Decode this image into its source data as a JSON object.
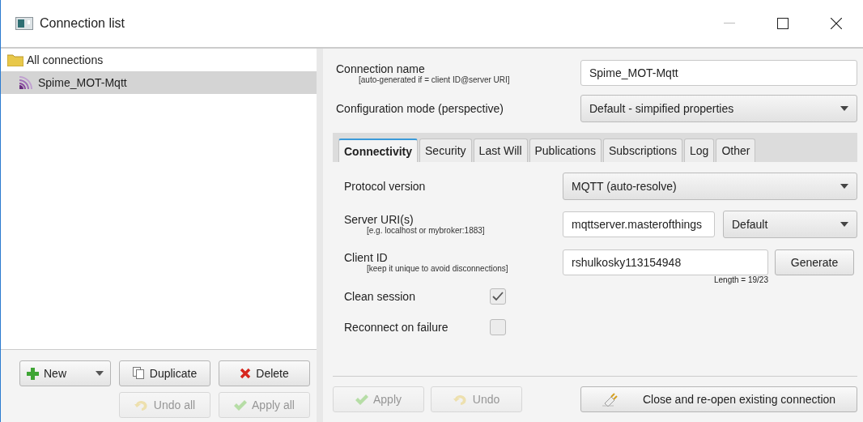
{
  "window": {
    "title": "Connection list"
  },
  "tree": [
    {
      "label": "All connections",
      "kind": "folder",
      "selected": false
    },
    {
      "label": "Spime_MOT-Mqtt",
      "kind": "connection",
      "selected": true
    }
  ],
  "list_buttons": [
    {
      "label": "New",
      "kind": "new",
      "disabled": false
    },
    {
      "label": "Duplicate",
      "kind": "duplicate",
      "disabled": false
    },
    {
      "label": "Delete",
      "kind": "delete",
      "disabled": false
    },
    {
      "label": "Undo all",
      "kind": "undo",
      "disabled": true
    },
    {
      "label": "Apply all",
      "kind": "apply",
      "disabled": true
    }
  ],
  "connection_name": {
    "label": "Connection name",
    "hint": "[auto-generated if = client ID@server URI]",
    "value": "Spime_MOT-Mqtt"
  },
  "configuration_mode": {
    "label": "Configuration mode (perspective)",
    "value": "Default - simpified properties"
  },
  "tabs": [
    {
      "label": "Connectivity",
      "selected": true
    },
    {
      "label": "Security",
      "selected": false
    },
    {
      "label": "Last Will",
      "selected": false
    },
    {
      "label": "Publications",
      "selected": false
    },
    {
      "label": "Subscriptions",
      "selected": false
    },
    {
      "label": "Log",
      "selected": false
    },
    {
      "label": "Other",
      "selected": false
    }
  ],
  "protocol_version": {
    "label": "Protocol version",
    "value": "MQTT (auto-resolve)"
  },
  "server_uri": {
    "label": "Server URI(s)",
    "hint": "[e.g. localhost or mybroker:1883]",
    "value": "mqttserver.masterofthings",
    "mode": "Default"
  },
  "client_id": {
    "label": "Client ID",
    "hint": "[keep it unique to avoid disconnections]",
    "value": "rshulkosky113154948",
    "length": "Length = 19/23",
    "button": "Generate"
  },
  "options": [
    {
      "label": "Clean session",
      "checked": true
    },
    {
      "label": "Reconnect on failure",
      "checked": false
    }
  ],
  "bottom_buttons": [
    {
      "label": "Apply",
      "kind": "apply",
      "disabled": true
    },
    {
      "label": "Undo",
      "kind": "undo",
      "disabled": true
    },
    {
      "label": "Close and re-open existing connection",
      "kind": "reopen",
      "disabled": false
    }
  ]
}
